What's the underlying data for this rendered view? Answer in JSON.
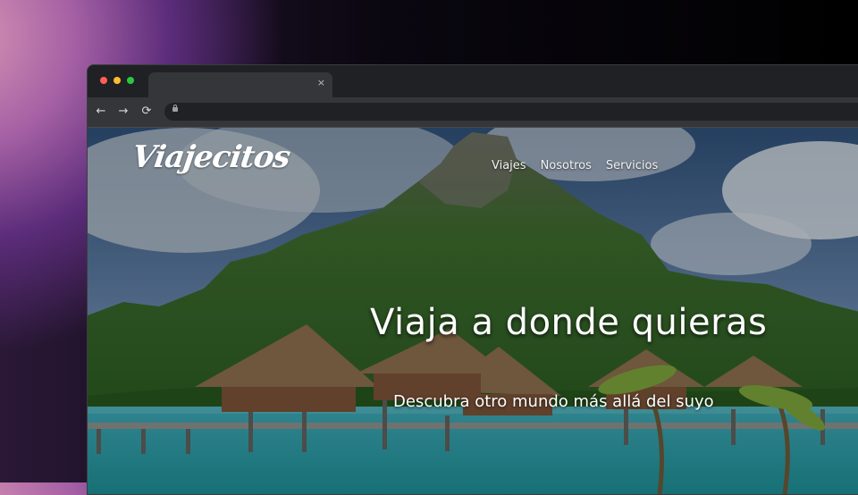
{
  "browser": {
    "window_dots": [
      "#ff5f57",
      "#febc2e",
      "#28c840"
    ],
    "tab_close": "×",
    "nav": {
      "back_icon": "←",
      "forward_icon": "→",
      "reload_icon": "⟳"
    }
  },
  "site": {
    "logo": "Viajecitos",
    "menu": [
      "Viajes",
      "Nosotros",
      "Servicios"
    ],
    "headline": "Viaja a donde quieras",
    "subheadline": "Descubra otro mundo más allá del suyo"
  }
}
